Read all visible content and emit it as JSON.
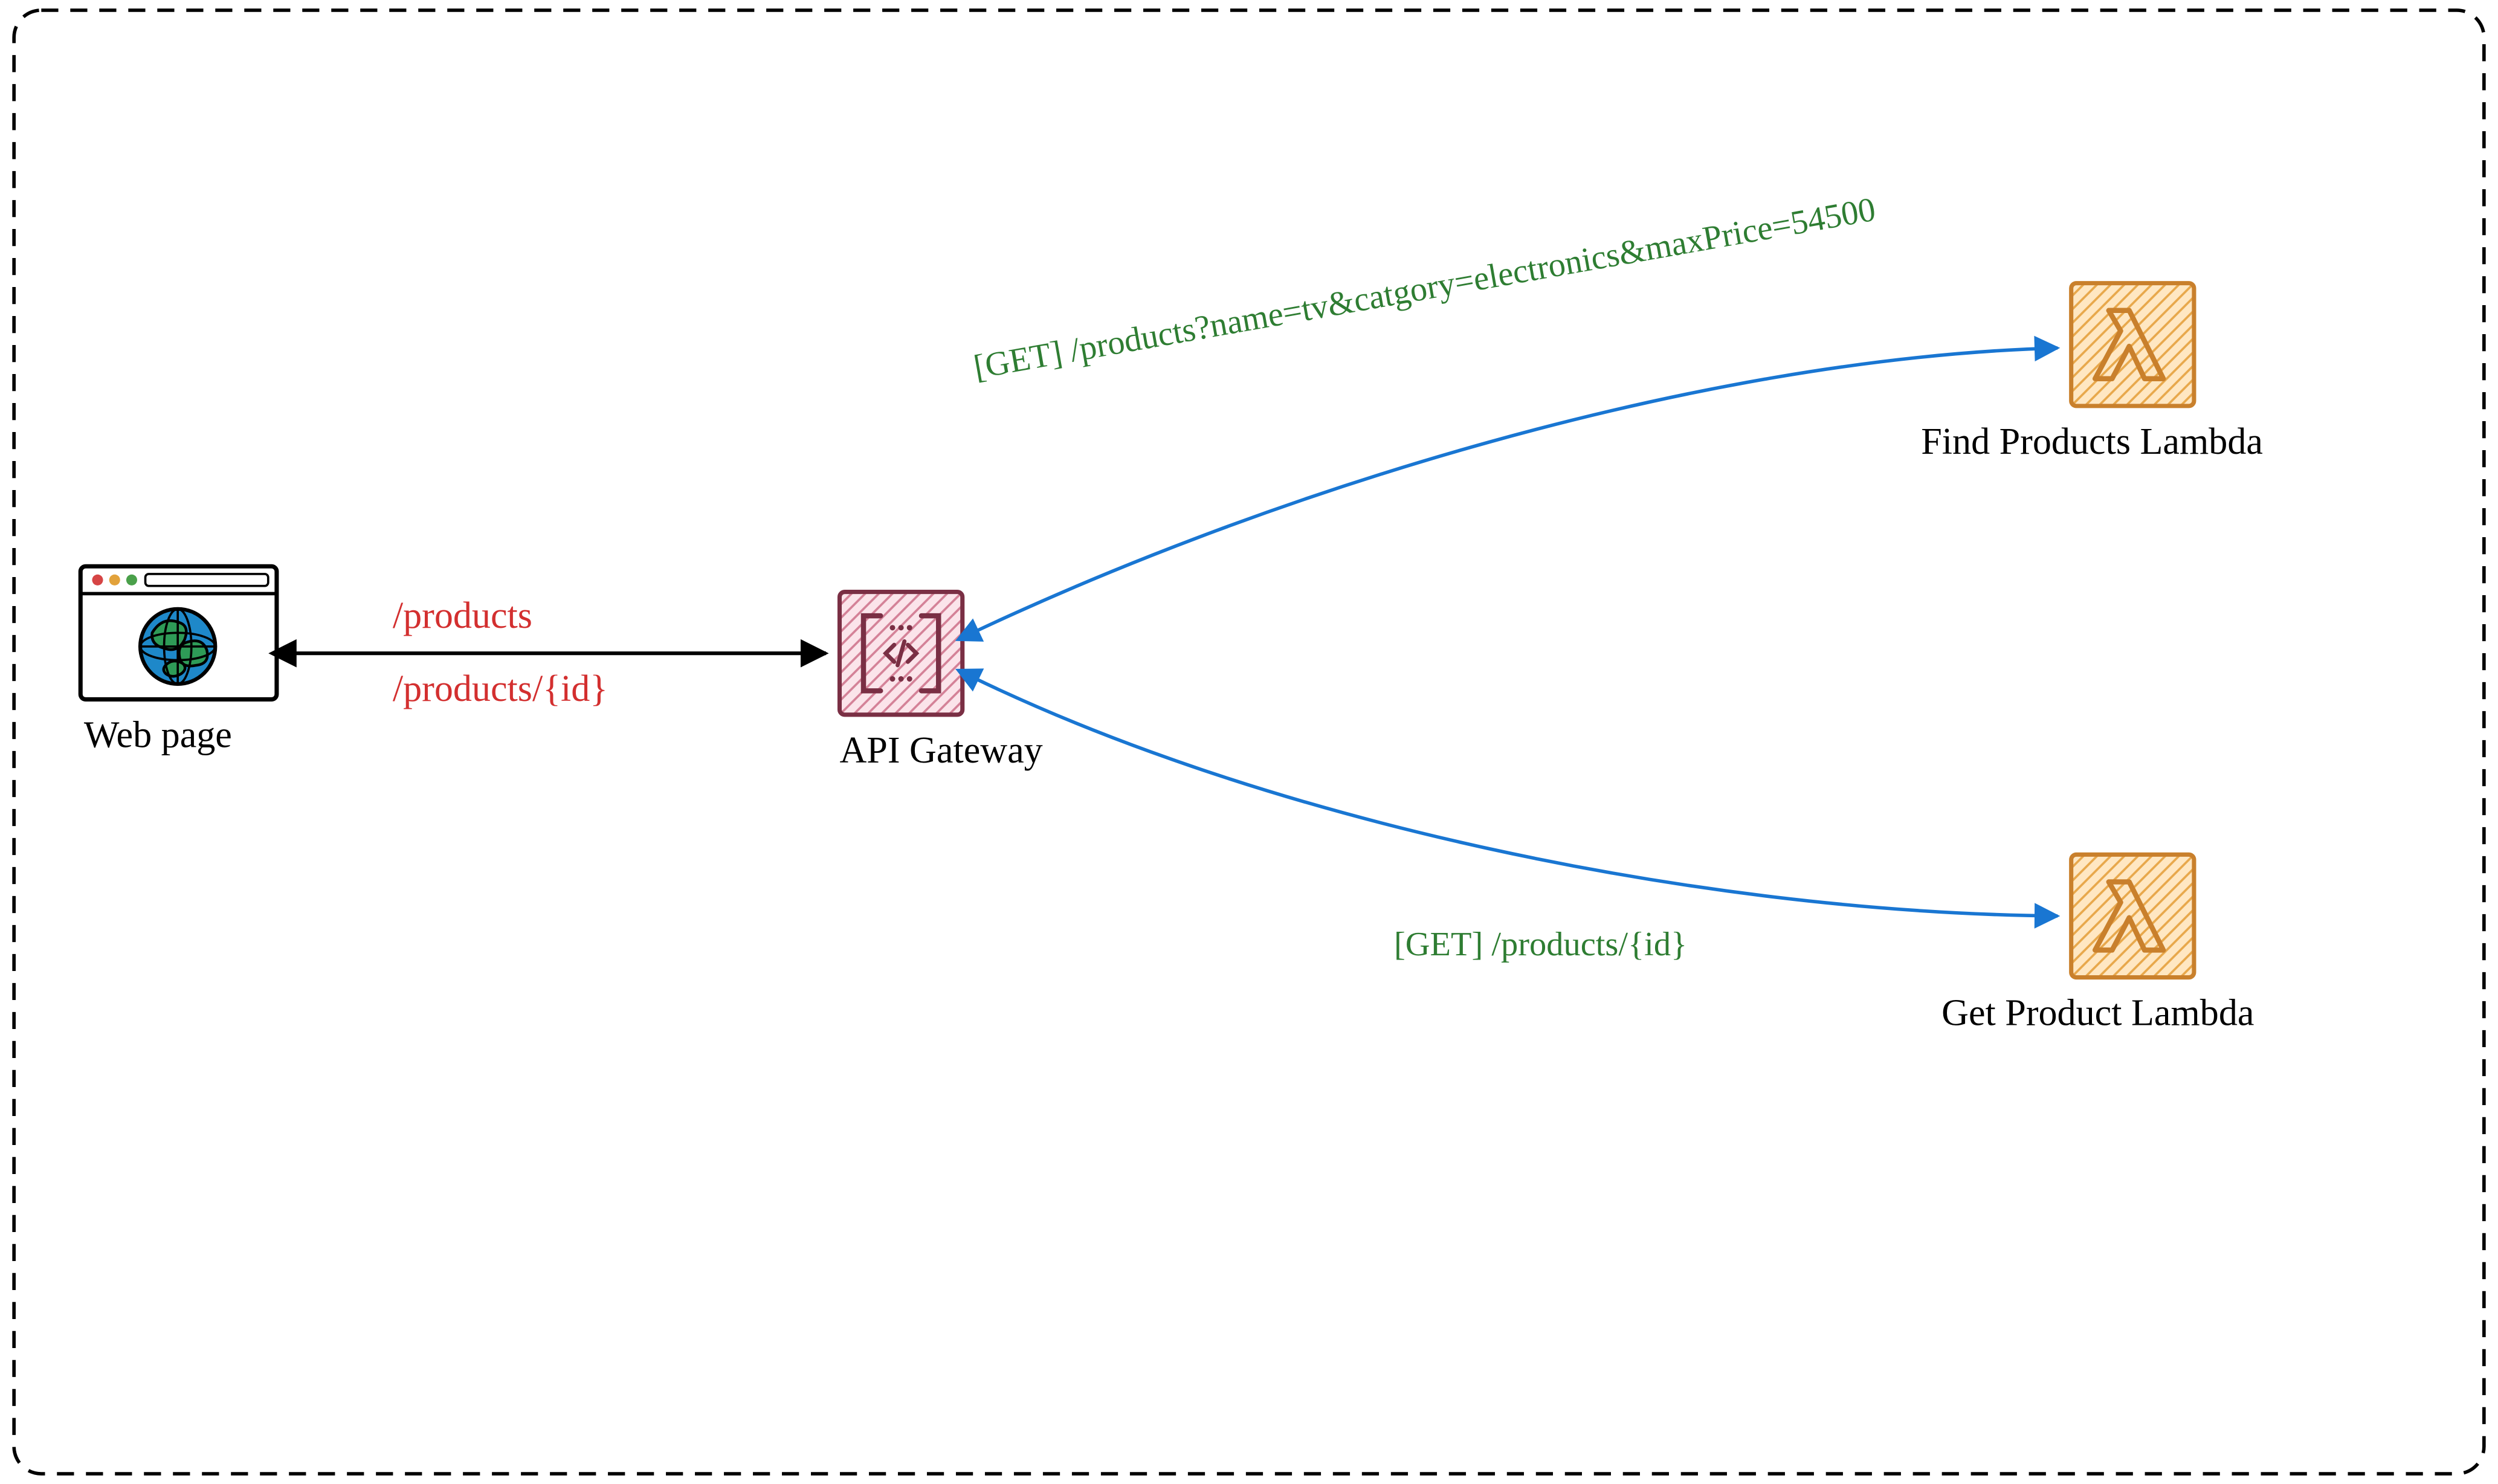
{
  "nodes": {
    "webpage": {
      "label": "Web page"
    },
    "api_gateway": {
      "label": "API Gateway"
    },
    "find_lambda": {
      "label": "Find Products Lambda"
    },
    "get_lambda": {
      "label": "Get Product Lambda"
    }
  },
  "edges": {
    "webpage_to_gateway": {
      "top_label": "/products",
      "bottom_label": "/products/{id}"
    },
    "gateway_to_find": {
      "label": "[GET] /products?name=tv&catgory=electronics&maxPrice=54500"
    },
    "gateway_to_get": {
      "label": "[GET] /products/{id}"
    }
  },
  "colors": {
    "border": "#000000",
    "red_text": "#d32f2f",
    "green_text": "#2e7d32",
    "blue_arrow": "#1976d2",
    "black_arrow": "#000000",
    "lambda_fill": "#ffe7c2",
    "lambda_hatch": "#e8a84b",
    "lambda_stroke": "#c9802c",
    "gateway_fill": "#fbe4ea",
    "gateway_hatch": "#c24b6a",
    "gateway_stroke": "#7a2f44",
    "globe_blue": "#1e88c9",
    "globe_green": "#2e9b57"
  }
}
